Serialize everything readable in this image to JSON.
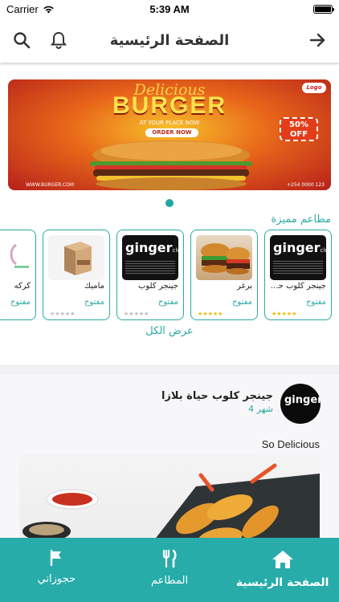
{
  "status_bar": {
    "carrier": "Carrier",
    "time": "5:39 AM",
    "battery_level": 1.0
  },
  "header": {
    "title": "الصفحة الرئيسية",
    "icons": [
      "search-icon",
      "bell-icon",
      "arrow-right-icon"
    ]
  },
  "banner": {
    "script_text": "Delicious",
    "headline": "BURGER",
    "subline": "AT YOUR PLACE NOW",
    "button": "ORDER NOW",
    "badge_line1": "50%",
    "badge_line2": "OFF",
    "logo": "Logo",
    "website": "WWW.BURGER.COM",
    "phone": "+254 0000 123"
  },
  "featured": {
    "title": "مطاعم مميزة",
    "show_all": "عرض الكل",
    "items": [
      {
        "name": "جينجر كلوب حيا...",
        "status": "مفتوح",
        "rating": 5,
        "image": "ginger-club-logo"
      },
      {
        "name": "برغر",
        "status": "مفتوح",
        "rating": 5,
        "image": "burger-photo"
      },
      {
        "name": "جينجر كلوب",
        "status": "مفتوح",
        "rating": 0,
        "image": "ginger-club-logo"
      },
      {
        "name": "ماميك",
        "status": "مفتوح",
        "rating": 0,
        "image": "mamig-boxes"
      },
      {
        "name": "كركه",
        "status": "مفتوح",
        "rating": 0,
        "image": "karak-logo"
      }
    ]
  },
  "post": {
    "author": "جينجر كلوب حياة بلازا",
    "time": "4 شهر",
    "text": "So Delicious",
    "avatar_text": "ginger"
  },
  "colors": {
    "accent": "#2aa9a4",
    "tabbar": "#27aca9",
    "star_on": "#f5b800",
    "star_off": "#bbbbbb"
  },
  "tabbar": {
    "tabs": [
      {
        "label": "حجوزاتي",
        "icon": "flag-icon",
        "active": false
      },
      {
        "label": "المطاعم",
        "icon": "fork-knife-icon",
        "active": false
      },
      {
        "label": "الصفحة الرئيسية",
        "icon": "home-icon",
        "active": true
      }
    ]
  }
}
